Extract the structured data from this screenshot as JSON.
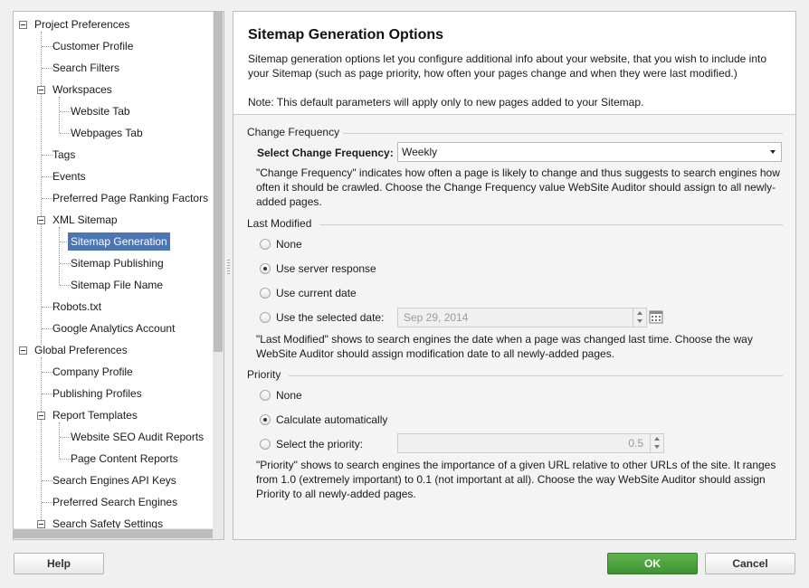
{
  "tree": {
    "items": [
      {
        "label": "Project Preferences"
      },
      {
        "label": "Customer Profile"
      },
      {
        "label": "Search Filters"
      },
      {
        "label": "Workspaces"
      },
      {
        "label": "Website Tab"
      },
      {
        "label": "Webpages Tab"
      },
      {
        "label": "Tags"
      },
      {
        "label": "Events"
      },
      {
        "label": "Preferred Page Ranking Factors"
      },
      {
        "label": "XML Sitemap"
      },
      {
        "label": "Sitemap Generation"
      },
      {
        "label": "Sitemap Publishing"
      },
      {
        "label": "Sitemap File Name"
      },
      {
        "label": "Robots.txt"
      },
      {
        "label": "Google Analytics Account"
      },
      {
        "label": "Global Preferences"
      },
      {
        "label": "Company Profile"
      },
      {
        "label": "Publishing Profiles"
      },
      {
        "label": "Report Templates"
      },
      {
        "label": "Website SEO Audit Reports"
      },
      {
        "label": "Page Content Reports"
      },
      {
        "label": "Search Engines API Keys"
      },
      {
        "label": "Preferred Search Engines"
      },
      {
        "label": "Search Safety Settings"
      }
    ],
    "selected": "Sitemap Generation"
  },
  "header": {
    "title": "Sitemap Generation Options",
    "description": "Sitemap generation options let you configure additional info about your website, that you wish to include into your Sitemap (such as page priority, how often your pages change and when they were last modified.)",
    "note": "Note: This default parameters will apply only to new pages added to your Sitemap."
  },
  "change_frequency": {
    "section_title": "Change Frequency",
    "select_label": "Select Change Frequency:",
    "selected_value": "Weekly",
    "help": "\"Change Frequency\" indicates how often a page is likely to change and thus suggests to search engines how often it should be crawled. Choose the Change Frequency value WebSite Auditor should assign to all newly-added pages."
  },
  "last_modified": {
    "section_title": "Last Modified",
    "options": [
      {
        "label": "None",
        "checked": false
      },
      {
        "label": "Use server response",
        "checked": true
      },
      {
        "label": "Use current date",
        "checked": false
      },
      {
        "label": "Use the selected date:",
        "checked": false
      }
    ],
    "date_value": "Sep 29, 2014",
    "help": "\"Last Modified\" shows to search engines the date when a page was changed last time. Choose the way WebSite Auditor should assign modification date to all newly-added pages."
  },
  "priority": {
    "section_title": "Priority",
    "options": [
      {
        "label": "None",
        "checked": false
      },
      {
        "label": "Calculate automatically",
        "checked": true
      },
      {
        "label": "Select the priority:",
        "checked": false
      }
    ],
    "priority_value": "0.5",
    "help": "\"Priority\" shows to search engines the importance of a given URL relative to other URLs of the site. It ranges from 1.0 (extremely important) to 0.1 (not important at all). Choose the way WebSite Auditor should assign Priority to all newly-added pages."
  },
  "buttons": {
    "help": "Help",
    "ok": "OK",
    "cancel": "Cancel"
  },
  "colors": {
    "selection": "#4a76b8",
    "ok_green": "#4aa33c"
  }
}
